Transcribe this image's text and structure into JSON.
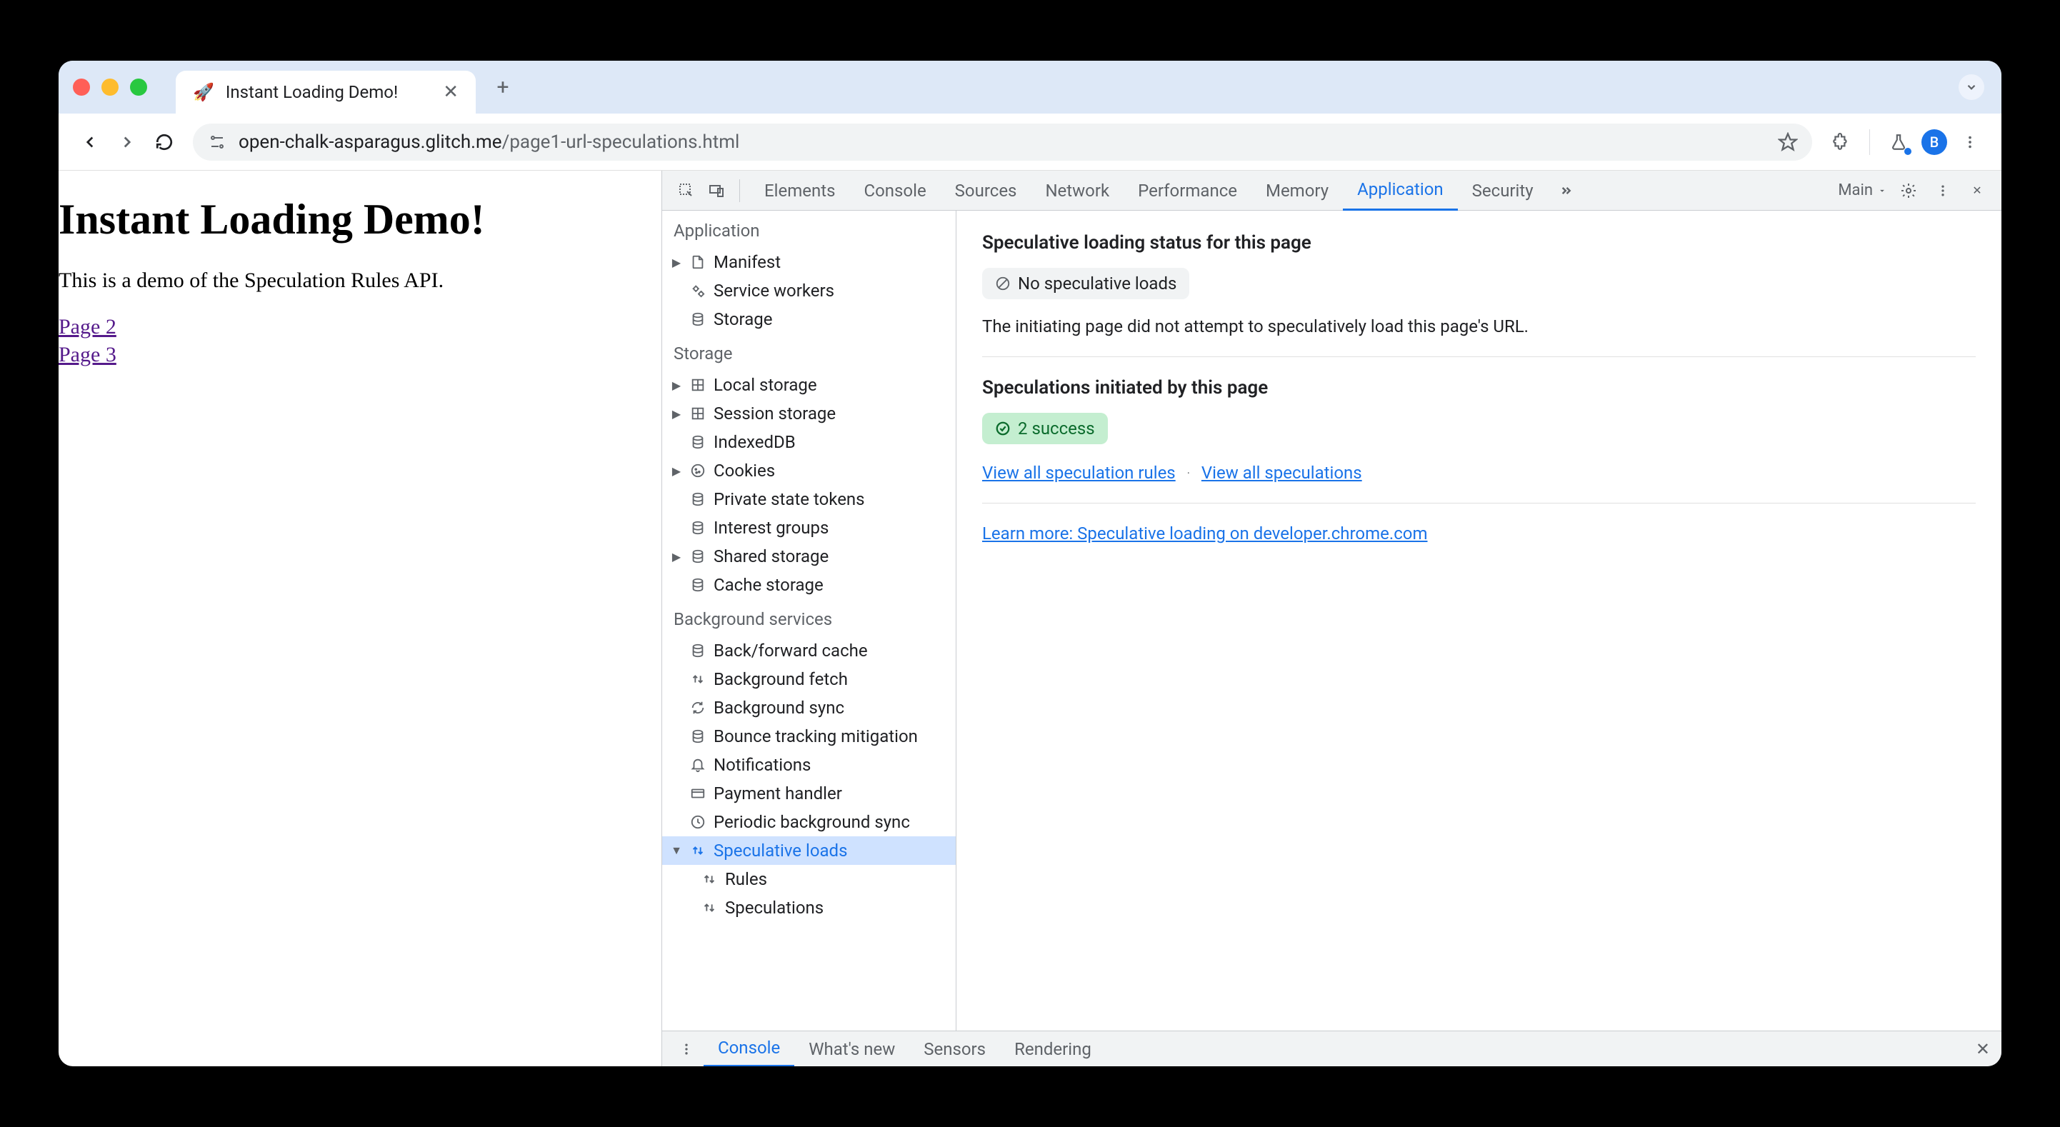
{
  "browser": {
    "tab": {
      "favicon": "🚀",
      "title": "Instant Loading Demo!"
    },
    "url": {
      "domain": "open-chalk-asparagus.glitch.me",
      "path": "/page1-url-speculations.html"
    },
    "avatar_letter": "B"
  },
  "page": {
    "heading": "Instant Loading Demo!",
    "intro": "This is a demo of the Speculation Rules API.",
    "links": [
      "Page 2",
      "Page 3"
    ]
  },
  "devtools": {
    "tabs": [
      "Elements",
      "Console",
      "Sources",
      "Network",
      "Performance",
      "Memory",
      "Application",
      "Security"
    ],
    "active_tab": "Application",
    "frame_label": "Main",
    "sidebar": {
      "sections": [
        {
          "title": "Application",
          "items": [
            {
              "label": "Manifest",
              "icon": "file",
              "expandable": true
            },
            {
              "label": "Service workers",
              "icon": "gears"
            },
            {
              "label": "Storage",
              "icon": "db"
            }
          ]
        },
        {
          "title": "Storage",
          "items": [
            {
              "label": "Local storage",
              "icon": "grid",
              "expandable": true
            },
            {
              "label": "Session storage",
              "icon": "grid",
              "expandable": true
            },
            {
              "label": "IndexedDB",
              "icon": "db"
            },
            {
              "label": "Cookies",
              "icon": "cookie",
              "expandable": true
            },
            {
              "label": "Private state tokens",
              "icon": "db"
            },
            {
              "label": "Interest groups",
              "icon": "db"
            },
            {
              "label": "Shared storage",
              "icon": "db",
              "expandable": true
            },
            {
              "label": "Cache storage",
              "icon": "db"
            }
          ]
        },
        {
          "title": "Background services",
          "items": [
            {
              "label": "Back/forward cache",
              "icon": "db"
            },
            {
              "label": "Background fetch",
              "icon": "updown"
            },
            {
              "label": "Background sync",
              "icon": "sync"
            },
            {
              "label": "Bounce tracking mitigation",
              "icon": "db"
            },
            {
              "label": "Notifications",
              "icon": "bell"
            },
            {
              "label": "Payment handler",
              "icon": "card"
            },
            {
              "label": "Periodic background sync",
              "icon": "clock"
            },
            {
              "label": "Speculative loads",
              "icon": "updown",
              "expandable": true,
              "expanded": true,
              "selected": true,
              "children": [
                {
                  "label": "Rules",
                  "icon": "updown"
                },
                {
                  "label": "Speculations",
                  "icon": "updown"
                }
              ]
            }
          ]
        }
      ]
    },
    "main": {
      "status_section": {
        "title": "Speculative loading status for this page",
        "badge": "No speculative loads",
        "note": "The initiating page did not attempt to speculatively load this page's URL."
      },
      "initiated_section": {
        "title": "Speculations initiated by this page",
        "badge": "2 success",
        "rules_link": "View all speculation rules",
        "specs_link": "View all speculations"
      },
      "learn_more": "Learn more: Speculative loading on developer.chrome.com"
    },
    "bottom_tabs": [
      "Console",
      "What's new",
      "Sensors",
      "Rendering"
    ],
    "bottom_active": "Console"
  }
}
